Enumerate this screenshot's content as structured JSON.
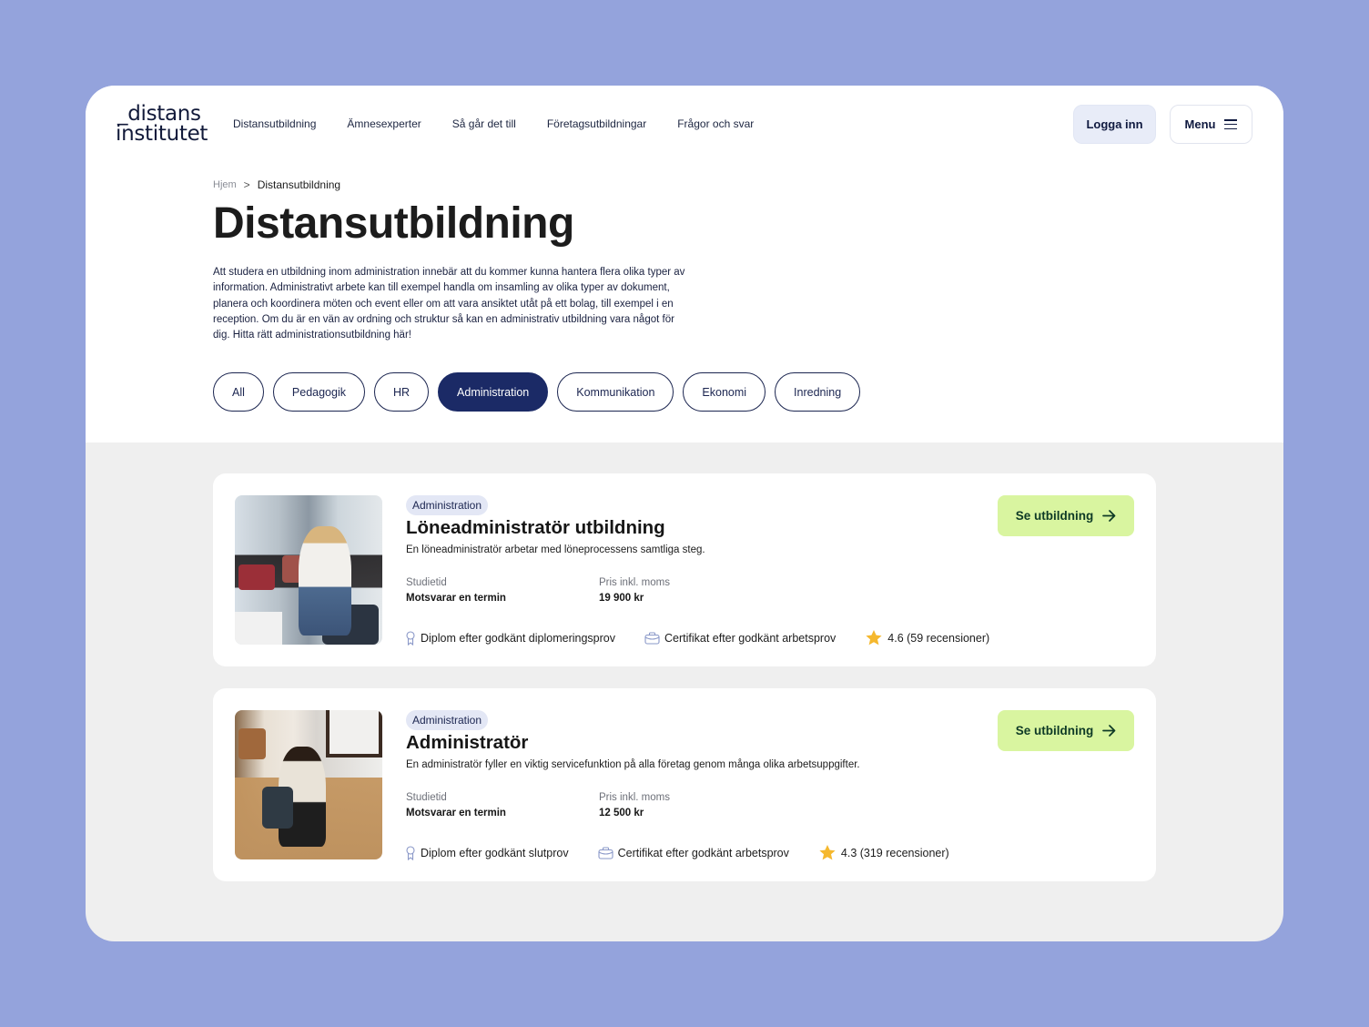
{
  "header": {
    "logo": {
      "line1": "_distans",
      "line2": "institutet"
    },
    "nav": [
      "Distansutbildning",
      "Ämnesexperter",
      "Så går det till",
      "Företagsutbildningar",
      "Frågor och svar"
    ],
    "login_label": "Logga inn",
    "menu_label": "Menu"
  },
  "breadcrumb": {
    "home": "Hjem",
    "separator": ">",
    "current": "Distansutbildning"
  },
  "page": {
    "title": "Distansutbildning",
    "intro": "Att studera en utbildning inom administration innebär att du kommer kunna hantera flera olika typer av information. Administrativt arbete kan till exempel handla om insamling av olika typer av dokument, planera och koordinera möten och event eller om att vara ansiktet utåt på ett bolag, till exempel i en reception. Om du är en vän av ordning och struktur så kan en administrativ utbildning vara något för dig. Hitta rätt administrationsutbildning här!"
  },
  "filters": {
    "active": "Administration",
    "items": [
      "All",
      "Pedagogik",
      "HR",
      "Administration",
      "Kommunikation",
      "Ekonomi",
      "Inredning"
    ]
  },
  "courses": [
    {
      "tag": "Administration",
      "title": "Löneadministratör utbildning",
      "description": "En löneadministratör arbetar med löneprocessens samtliga steg.",
      "study_time_label": "Studietid",
      "study_time": "Motsvarar en termin",
      "price_label": "Pris inkl. moms",
      "price": "19 900 kr",
      "diploma": "Diplom efter godkänt diplomeringsprov",
      "certificate": "Certifikat efter godkänt arbetsprov",
      "rating": "4.6 (59 recensioner)",
      "cta": "Se utbildning",
      "image_alt": "woman-with-laptop-in-lounge"
    },
    {
      "tag": "Administration",
      "title": "Administratör",
      "description": "En administratör fyller en viktig servicefunktion på alla företag genom många olika arbetsuppgifter.",
      "study_time_label": "Studietid",
      "study_time": "Motsvarar en termin",
      "price_label": "Pris inkl. moms",
      "price": "12 500 kr",
      "diploma": "Diplom efter godkänt slutprov",
      "certificate": "Certifikat efter godkänt arbetsprov",
      "rating": "4.3 (319 recensioner)",
      "cta": "Se utbildning",
      "image_alt": "man-with-laptop-on-sofa"
    }
  ],
  "colors": {
    "page_bg": "#94a3dc",
    "accent_navy": "#1b2a66",
    "cta_green": "#d9f5a0",
    "tag_bg": "#e3e7f5",
    "star": "#f5b82e"
  }
}
